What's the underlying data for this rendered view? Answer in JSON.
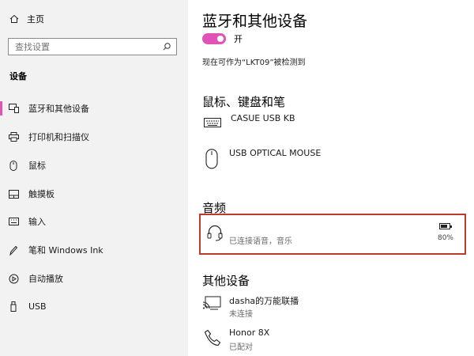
{
  "accent": "#e052b6",
  "sidebar": {
    "home_label": "主页",
    "search_placeholder": "查找设置",
    "section_title": "设备",
    "items": [
      {
        "label": "蓝牙和其他设备",
        "icon": "bluetooth-devices-icon"
      },
      {
        "label": "打印机和扫描仪",
        "icon": "printer-icon"
      },
      {
        "label": "鼠标",
        "icon": "mouse-icon"
      },
      {
        "label": "触摸板",
        "icon": "touchpad-icon"
      },
      {
        "label": "输入",
        "icon": "keyboard-icon"
      },
      {
        "label": "笔和 Windows Ink",
        "icon": "pen-icon"
      },
      {
        "label": "自动播放",
        "icon": "autoplay-icon"
      },
      {
        "label": "USB",
        "icon": "usb-icon"
      }
    ]
  },
  "main": {
    "page_title": "蓝牙和其他设备",
    "bluetooth_toggle": {
      "state_label": "开",
      "on": true
    },
    "discoverable_text": "现在可作为“LKT09”被检测到",
    "mouse_section": {
      "title": "鼠标、键盘和笔",
      "devices": [
        {
          "name": "CASUE USB KB",
          "icon": "keyboard-icon"
        },
        {
          "name": "USB OPTICAL MOUSE",
          "icon": "mouse-icon"
        }
      ]
    },
    "audio_section": {
      "title": "音频",
      "device": {
        "status": "已连接语音，音乐",
        "battery": "80%",
        "battery_level": 0.8,
        "icon": "headset-icon"
      }
    },
    "other_section": {
      "title": "其他设备",
      "devices": [
        {
          "name": "dasha的万能联播",
          "status": "未连接",
          "icon": "display-cast-icon"
        },
        {
          "name": "Honor 8X",
          "status": "已配对",
          "icon": "phone-icon"
        }
      ]
    },
    "highlight_color": "#c0392b"
  }
}
